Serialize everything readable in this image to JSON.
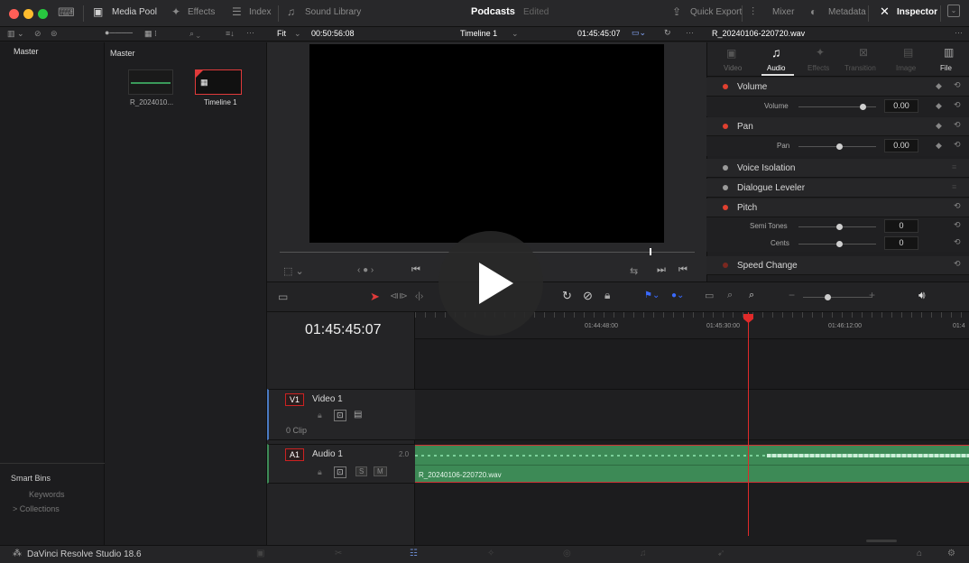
{
  "topbar": {
    "media_pool": "Media Pool",
    "effects": "Effects",
    "index": "Index",
    "sound_library": "Sound Library",
    "project_title": "Podcasts",
    "project_status": "Edited",
    "quick_export": "Quick Export",
    "mixer": "Mixer",
    "metadata": "Metadata",
    "inspector": "Inspector"
  },
  "viewer_bar": {
    "fit": "Fit",
    "source_timecode": "00:50:56:08",
    "timeline_name": "Timeline 1",
    "record_timecode": "01:45:45:07",
    "clip_name": "R_20240106-220720.wav"
  },
  "media_pool": {
    "bin_root": "Master",
    "bin_header": "Master",
    "items": [
      {
        "label": "R_2024010..."
      },
      {
        "label": "Timeline 1"
      }
    ],
    "smart_bins": "Smart Bins",
    "smart_items": [
      "Keywords",
      "> Collections"
    ]
  },
  "inspector": {
    "tabs": [
      "Video",
      "Audio",
      "Effects",
      "Transition",
      "Image",
      "File"
    ],
    "active_tab": "Audio",
    "sections": {
      "volume": "Volume",
      "volume_param": "Volume",
      "volume_value": "0.00",
      "pan": "Pan",
      "pan_param": "Pan",
      "pan_value": "0.00",
      "voice_isolation": "Voice Isolation",
      "dialogue_leveler": "Dialogue Leveler",
      "pitch": "Pitch",
      "semi_tones": "Semi Tones",
      "semi_tones_value": "0",
      "cents": "Cents",
      "cents_value": "0",
      "speed_change": "Speed Change"
    }
  },
  "timeline": {
    "timecode": "01:45:45:07",
    "ruler_ticks": [
      "01:44:48:00",
      "01:45:30:00",
      "01:46:12:00",
      "01:4"
    ],
    "tracks": {
      "v1_badge": "V1",
      "v1_name": "Video 1",
      "v1_clips": "0 Clip",
      "a1_badge": "A1",
      "a1_name": "Audio 1",
      "a1_channels": "2.0",
      "a1_solo": "S",
      "a1_mute": "M"
    },
    "audio_clip_name": "R_20240106-220720.wav"
  },
  "footer": {
    "app_name": "DaVinci Resolve Studio 18.6"
  },
  "colors": {
    "accent_red": "#e04030",
    "audio_clip_green": "#3d8a56",
    "playhead_red": "#e02a2a"
  }
}
